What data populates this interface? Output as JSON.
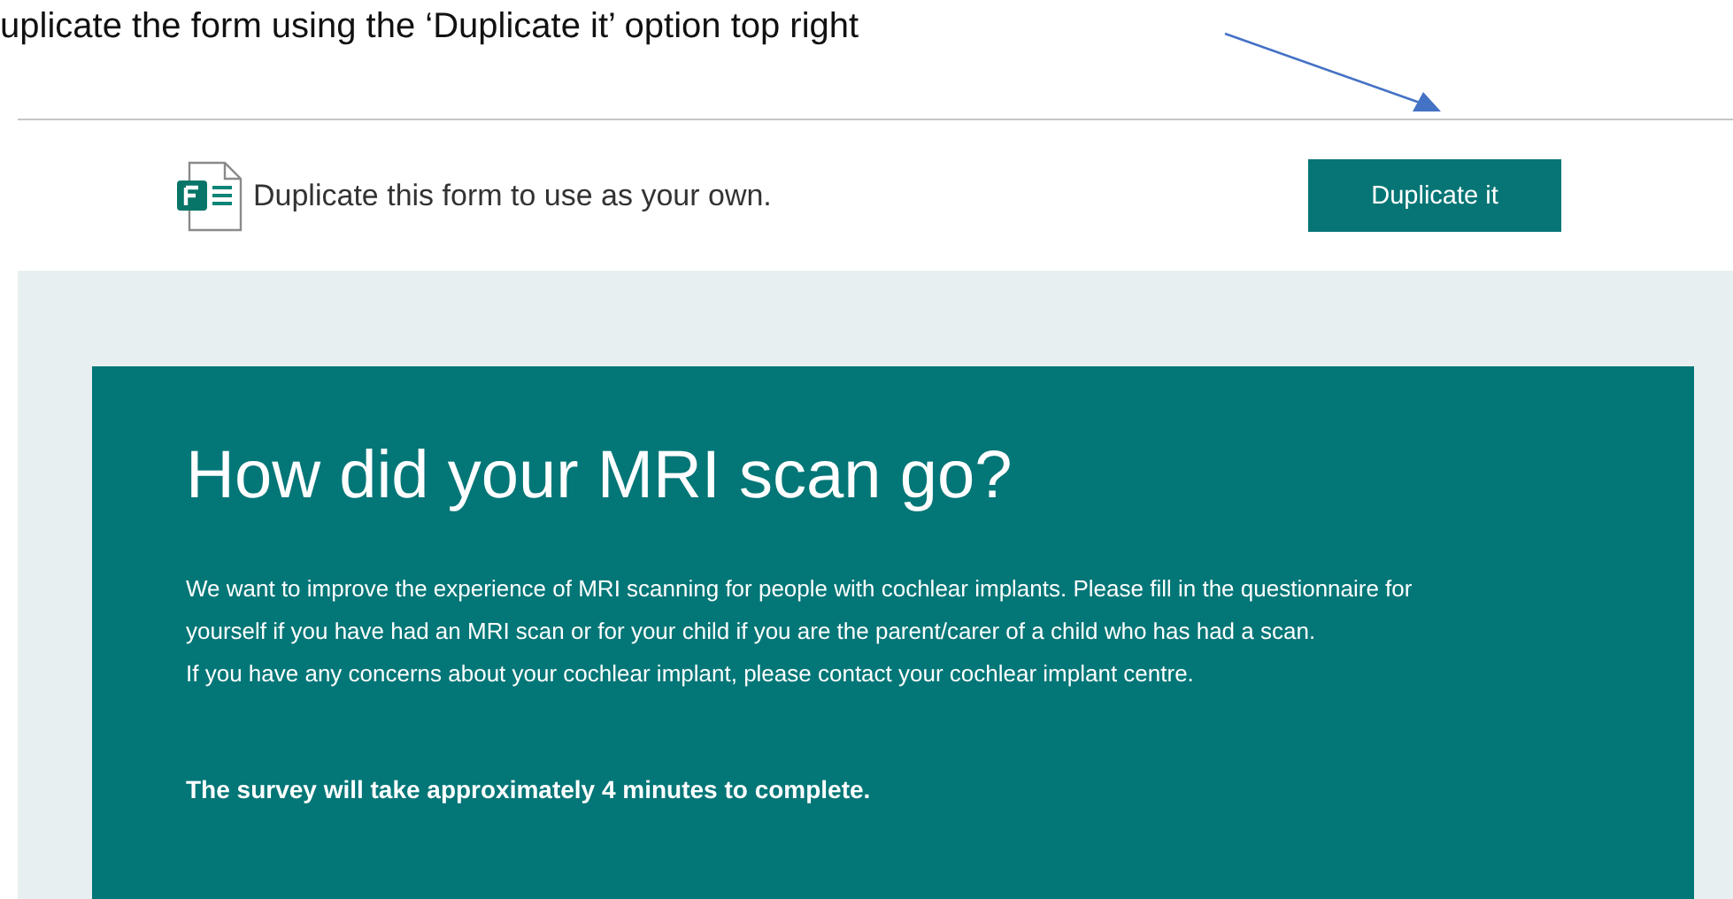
{
  "caption": "uplicate the form using the ‘Duplicate it’ option top right",
  "banner": {
    "message": "Duplicate this form to use as your own.",
    "button": "Duplicate it"
  },
  "form": {
    "title": "How did your MRI scan go?",
    "paragraphs": [
      "We want to improve the experience of MRI scanning for people with cochlear implants.  Please fill in the questionnaire for yourself if you have had an MRI scan or for your child if you are the parent/carer of a child who has had a scan.",
      "If you have any concerns about your cochlear implant, please contact your cochlear implant centre."
    ],
    "note": "The survey will take approximately 4 minutes to complete."
  }
}
